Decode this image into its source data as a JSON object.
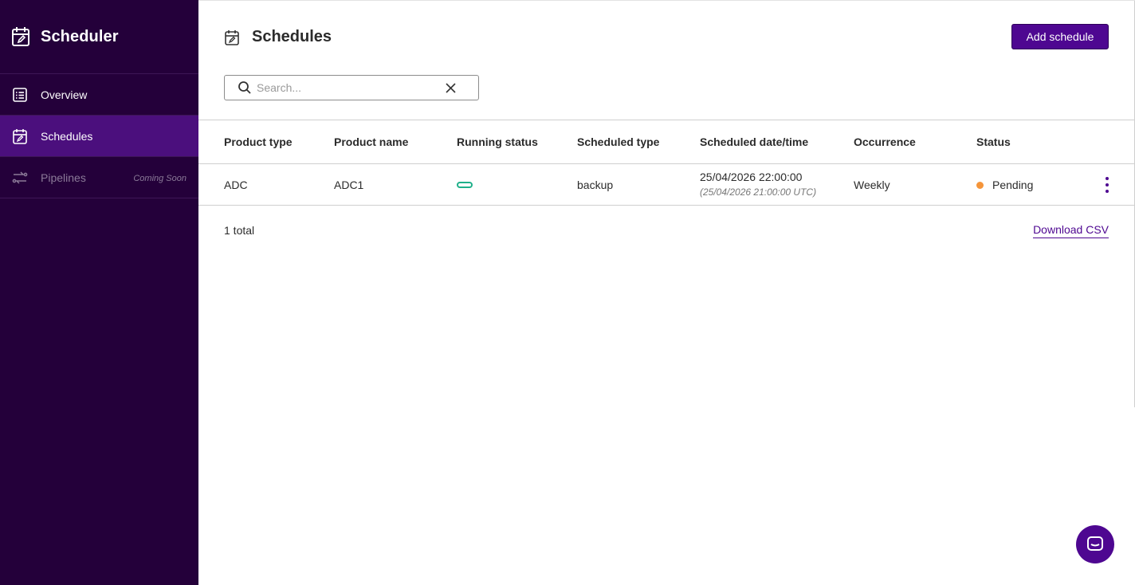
{
  "app": {
    "title": "Scheduler"
  },
  "sidebar": {
    "items": [
      {
        "label": "Overview",
        "icon": "list-icon"
      },
      {
        "label": "Schedules",
        "icon": "calendar-edit-icon",
        "active": true
      },
      {
        "label": "Pipelines",
        "icon": "pipeline-icon",
        "badge": "Coming Soon",
        "disabled": true
      }
    ]
  },
  "page": {
    "title": "Schedules",
    "add_button": "Add schedule"
  },
  "search": {
    "placeholder": "Search...",
    "value": ""
  },
  "table": {
    "columns": [
      "Product type",
      "Product name",
      "Running status",
      "Scheduled type",
      "Scheduled date/time",
      "Occurrence",
      "Status"
    ],
    "rows": [
      {
        "product_type": "ADC",
        "product_name": "ADC1",
        "running_status": "toggle-off",
        "scheduled_type": "backup",
        "scheduled_datetime": "25/04/2026 22:00:00",
        "scheduled_datetime_utc": "(25/04/2026 21:00:00 UTC)",
        "occurrence": "Weekly",
        "status": "Pending"
      }
    ]
  },
  "footer": {
    "total": "1 total",
    "download": "Download CSV"
  },
  "colors": {
    "sidebar_bg": "#24003a",
    "active_bg": "#4b0f7d",
    "primary": "#4e0791",
    "running_status": "#1fb08a",
    "status_pending": "#f5953a"
  }
}
